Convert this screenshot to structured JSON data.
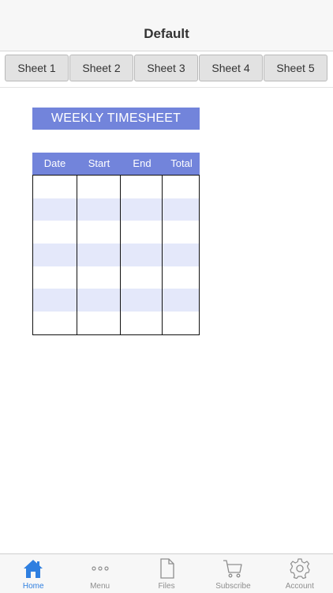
{
  "navbar": {
    "title": "Default"
  },
  "sheets": [
    {
      "label": "Sheet 1"
    },
    {
      "label": "Sheet 2"
    },
    {
      "label": "Sheet 3"
    },
    {
      "label": "Sheet 4"
    },
    {
      "label": "Sheet 5"
    }
  ],
  "timesheet": {
    "title": "WEEKLY TIMESHEET",
    "columns": [
      "Date",
      "Start",
      "End",
      "Total"
    ],
    "rows": [
      [
        "",
        "",
        "",
        ""
      ],
      [
        "",
        "",
        "",
        ""
      ],
      [
        "",
        "",
        "",
        ""
      ],
      [
        "",
        "",
        "",
        ""
      ],
      [
        "",
        "",
        "",
        ""
      ],
      [
        "",
        "",
        "",
        ""
      ],
      [
        "",
        "",
        "",
        ""
      ]
    ],
    "colors": {
      "header": "#7284db",
      "stripe": "#e4e8fa",
      "header_text": "#ffffff"
    }
  },
  "tabbar": {
    "active_color": "#2f7fe0",
    "items": [
      {
        "label": "Home",
        "icon": "home-icon"
      },
      {
        "label": "Menu",
        "icon": "more-icon"
      },
      {
        "label": "Files",
        "icon": "file-icon"
      },
      {
        "label": "Subscribe",
        "icon": "cart-icon"
      },
      {
        "label": "Account",
        "icon": "gear-icon"
      }
    ]
  }
}
